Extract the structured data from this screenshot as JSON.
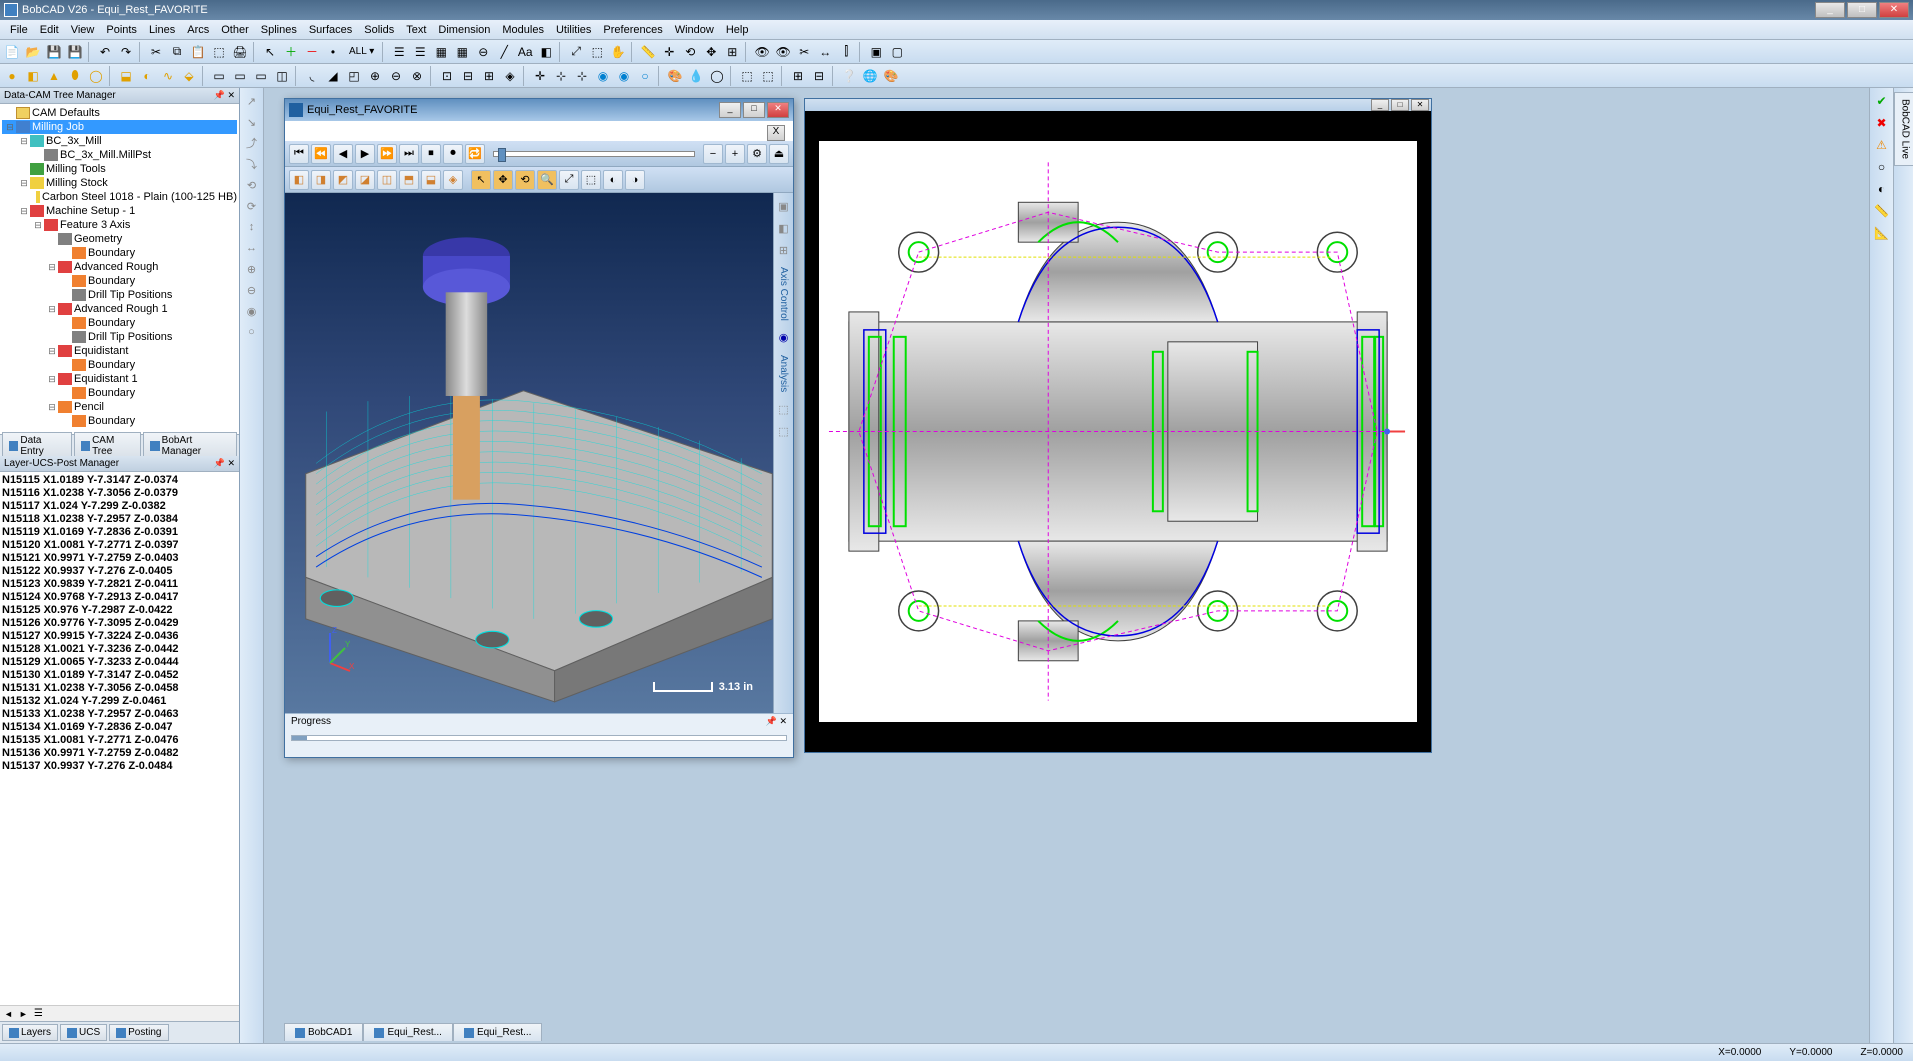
{
  "window": {
    "title": "BobCAD V26 - Equi_Rest_FAVORITE",
    "min": "_",
    "max": "□",
    "close": "✕"
  },
  "menu": [
    "File",
    "Edit",
    "View",
    "Points",
    "Lines",
    "Arcs",
    "Other",
    "Splines",
    "Surfaces",
    "Solids",
    "Text",
    "Dimension",
    "Modules",
    "Utilities",
    "Preferences",
    "Window",
    "Help"
  ],
  "tree_panel": {
    "title": "Data-CAM Tree Manager"
  },
  "tree": [
    {
      "lvl": 0,
      "exp": "",
      "ico": "ico-folder",
      "label": "CAM Defaults"
    },
    {
      "lvl": 0,
      "exp": "⊟",
      "ico": "ico-blue",
      "label": "Milling Job",
      "sel": true
    },
    {
      "lvl": 1,
      "exp": "⊟",
      "ico": "ico-cyan",
      "label": "BC_3x_Mill"
    },
    {
      "lvl": 2,
      "exp": "",
      "ico": "ico-gray",
      "label": "BC_3x_Mill.MillPst"
    },
    {
      "lvl": 1,
      "exp": "",
      "ico": "ico-green",
      "label": "Milling Tools"
    },
    {
      "lvl": 1,
      "exp": "⊟",
      "ico": "ico-yellow",
      "label": "Milling Stock"
    },
    {
      "lvl": 2,
      "exp": "",
      "ico": "ico-yellow",
      "label": "Carbon Steel 1018 - Plain (100-125 HB)"
    },
    {
      "lvl": 1,
      "exp": "⊟",
      "ico": "ico-red",
      "label": "Machine Setup - 1"
    },
    {
      "lvl": 2,
      "exp": "⊟",
      "ico": "ico-red",
      "label": "Feature 3 Axis"
    },
    {
      "lvl": 3,
      "exp": "",
      "ico": "ico-gray",
      "label": "Geometry"
    },
    {
      "lvl": 4,
      "exp": "",
      "ico": "ico-orange",
      "label": "Boundary"
    },
    {
      "lvl": 3,
      "exp": "⊟",
      "ico": "ico-red",
      "label": "Advanced Rough"
    },
    {
      "lvl": 4,
      "exp": "",
      "ico": "ico-orange",
      "label": "Boundary"
    },
    {
      "lvl": 4,
      "exp": "",
      "ico": "ico-gray",
      "label": "Drill Tip Positions"
    },
    {
      "lvl": 3,
      "exp": "⊟",
      "ico": "ico-red",
      "label": "Advanced Rough 1"
    },
    {
      "lvl": 4,
      "exp": "",
      "ico": "ico-orange",
      "label": "Boundary"
    },
    {
      "lvl": 4,
      "exp": "",
      "ico": "ico-gray",
      "label": "Drill Tip Positions"
    },
    {
      "lvl": 3,
      "exp": "⊟",
      "ico": "ico-red",
      "label": "Equidistant"
    },
    {
      "lvl": 4,
      "exp": "",
      "ico": "ico-orange",
      "label": "Boundary"
    },
    {
      "lvl": 3,
      "exp": "⊟",
      "ico": "ico-red",
      "label": "Equidistant 1"
    },
    {
      "lvl": 4,
      "exp": "",
      "ico": "ico-orange",
      "label": "Boundary"
    },
    {
      "lvl": 3,
      "exp": "⊟",
      "ico": "ico-orange",
      "label": "Pencil"
    },
    {
      "lvl": 4,
      "exp": "",
      "ico": "ico-orange",
      "label": "Boundary"
    }
  ],
  "tree_tabs": [
    "Data Entry",
    "CAM Tree",
    "BobArt Manager"
  ],
  "gcode_panel": {
    "title": "Layer-UCS-Post Manager"
  },
  "gcode": [
    "N15115 X1.0189 Y-7.3147 Z-0.0374",
    "N15116 X1.0238 Y-7.3056 Z-0.0379",
    "N15117 X1.024 Y-7.299 Z-0.0382",
    "N15118 X1.0238 Y-7.2957 Z-0.0384",
    "N15119 X1.0169 Y-7.2836 Z-0.0391",
    "N15120 X1.0081 Y-7.2771 Z-0.0397",
    "N15121 X0.9971 Y-7.2759 Z-0.0403",
    "N15122 X0.9937 Y-7.276 Z-0.0405",
    "N15123 X0.9839 Y-7.2821 Z-0.0411",
    "N15124 X0.9768 Y-7.2913 Z-0.0417",
    "N15125 X0.976 Y-7.2987 Z-0.0422",
    "N15126 X0.9776 Y-7.3095 Z-0.0429",
    "N15127 X0.9915 Y-7.3224 Z-0.0436",
    "N15128 X1.0021 Y-7.3236 Z-0.0442",
    "N15129 X1.0065 Y-7.3233 Z-0.0444",
    "N15130 X1.0189 Y-7.3147 Z-0.0452",
    "N15131 X1.0238 Y-7.3056 Z-0.0458",
    "N15132 X1.024 Y-7.299 Z-0.0461",
    "N15133 X1.0238 Y-7.2957 Z-0.0463",
    "N15134 X1.0169 Y-7.2836 Z-0.047",
    "N15135 X1.0081 Y-7.2771 Z-0.0476",
    "N15136 X0.9971 Y-7.2759 Z-0.0482",
    "N15137 X0.9937 Y-7.276 Z-0.0484"
  ],
  "gcode_tabs": [
    "Layers",
    "UCS",
    "Posting"
  ],
  "sim": {
    "title": "Equi_Rest_FAVORITE",
    "progress_label": "Progress",
    "scale": "3.13 in",
    "side_labels": [
      "Axis Control",
      "Analysis"
    ],
    "close_x": "X"
  },
  "doc_tabs": [
    "BobCAD1",
    "Equi_Rest...",
    "Equi_Rest..."
  ],
  "rightbar": {
    "label": "BobCAD Live"
  },
  "status": {
    "x": "X=0.0000",
    "y": "Y=0.0000",
    "z": "Z=0.0000"
  }
}
